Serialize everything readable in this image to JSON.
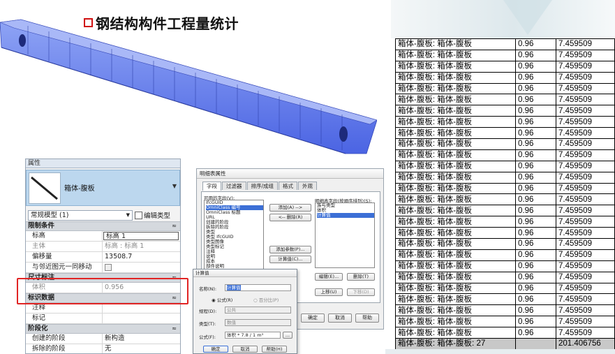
{
  "title": "钢结构构件工程量统计",
  "schedule": {
    "rows": [
      {
        "name": "箱体-腹板: 箱体-腹板",
        "value": "0.96",
        "volume": "7.459509"
      },
      {
        "name": "箱体-腹板: 箱体-腹板",
        "value": "0.96",
        "volume": "7.459509"
      },
      {
        "name": "箱体-腹板: 箱体-腹板",
        "value": "0.96",
        "volume": "7.459509"
      },
      {
        "name": "箱体-腹板: 箱体-腹板",
        "value": "0.96",
        "volume": "7.459509"
      },
      {
        "name": "箱体-腹板: 箱体-腹板",
        "value": "0.96",
        "volume": "7.459509"
      },
      {
        "name": "箱体-腹板: 箱体-腹板",
        "value": "0.96",
        "volume": "7.459509"
      },
      {
        "name": "箱体-腹板: 箱体-腹板",
        "value": "0.96",
        "volume": "7.459509"
      },
      {
        "name": "箱体-腹板: 箱体-腹板",
        "value": "0.96",
        "volume": "7.459509"
      },
      {
        "name": "箱体-腹板: 箱体-腹板",
        "value": "0.96",
        "volume": "7.459509"
      },
      {
        "name": "箱体-腹板: 箱体-腹板",
        "value": "0.96",
        "volume": "7.459509"
      },
      {
        "name": "箱体-腹板: 箱体-腹板",
        "value": "0.96",
        "volume": "7.459509"
      },
      {
        "name": "箱体-腹板: 箱体-腹板",
        "value": "0.96",
        "volume": "7.459509"
      },
      {
        "name": "箱体-腹板: 箱体-腹板",
        "value": "0.96",
        "volume": "7.459509"
      },
      {
        "name": "箱体-腹板: 箱体-腹板",
        "value": "0.96",
        "volume": "7.459509"
      },
      {
        "name": "箱体-腹板: 箱体-腹板",
        "value": "0.96",
        "volume": "7.459509"
      },
      {
        "name": "箱体-腹板: 箱体-腹板",
        "value": "0.96",
        "volume": "7.459509"
      },
      {
        "name": "箱体-腹板: 箱体-腹板",
        "value": "0.96",
        "volume": "7.459509"
      },
      {
        "name": "箱体-腹板: 箱体-腹板",
        "value": "0.96",
        "volume": "7.459509"
      },
      {
        "name": "箱体-腹板: 箱体-腹板",
        "value": "0.96",
        "volume": "7.459509"
      },
      {
        "name": "箱体-腹板: 箱体-腹板",
        "value": "0.96",
        "volume": "7.459509"
      },
      {
        "name": "箱体-腹板: 箱体-腹板",
        "value": "0.96",
        "volume": "7.459509"
      },
      {
        "name": "箱体-腹板: 箱体-腹板",
        "value": "0.96",
        "volume": "7.459509"
      },
      {
        "name": "箱体-腹板: 箱体-腹板",
        "value": "0.96",
        "volume": "7.459509"
      },
      {
        "name": "箱体-腹板: 箱体-腹板",
        "value": "0.96",
        "volume": "7.459509"
      },
      {
        "name": "箱体-腹板: 箱体-腹板",
        "value": "0.96",
        "volume": "7.459509"
      },
      {
        "name": "箱体-腹板: 箱体-腹板",
        "value": "0.96",
        "volume": "7.459509"
      },
      {
        "name": "箱体-腹板: 箱体-腹板",
        "value": "0.96",
        "volume": "7.459509"
      }
    ],
    "total": {
      "name": "箱体-腹板: 箱体-腹板: 27",
      "value": "",
      "volume": "201.406756"
    }
  },
  "properties": {
    "header": "属性",
    "type_name": "箱体-腹板",
    "filter_value": "常规模型 (1)",
    "edit_type_label": "编辑类型",
    "sections": {
      "constraints": "限制条件",
      "dimensions": "尺寸标注",
      "identity": "标识数据",
      "phasing": "阶段化"
    },
    "rows": {
      "level_key": "标高",
      "level_val": "标高 1",
      "host_key": "主体",
      "host_val": "标高 : 标高 1",
      "offset_key": "偏移量",
      "offset_val": "13508.7",
      "move_key": "与邻近图元一同移动",
      "volume_key": "体积",
      "volume_val": "0.956",
      "comment_key": "注释",
      "mark_key": "标记",
      "phase_created_key": "创建的阶段",
      "phase_created_val": "新构造",
      "phase_demolished_key": "拆除的阶段",
      "phase_demolished_val": "无"
    },
    "collapse_glyph": "≈"
  },
  "schedule_dialog": {
    "title": "明细表属性",
    "tabs": [
      "字段",
      "过滤器",
      "排序/成组",
      "格式",
      "外观"
    ],
    "available_label": "可用的字段(V):",
    "available_fields": [
      "IfcGUID",
      "OmniClass 编号",
      "OmniClass 标题",
      "URL",
      "创建的阶段",
      "拆除的阶段",
      "类型",
      "类型 IfcGUID",
      "类型图像",
      "类型标记",
      "注释",
      "说明",
      "成本",
      "部件说明",
      "部件代码",
      "族",
      "族与类型",
      "标高",
      "标记"
    ],
    "add_button": "添加(A) -->",
    "remove_button": "<-- 删除(R)",
    "add_param_button": "添加参数(P)...",
    "calc_button": "计算值(C)...",
    "scheduled_label": "明细表字段(按顺序排列)(S):",
    "scheduled_fields": [
      "族与类型",
      "体积",
      "计算值"
    ],
    "edit_button": "编辑(E)...",
    "delete_button": "删除(T)",
    "up_button": "上移(U)",
    "down_button": "下移(D)",
    "ok_button": "确定",
    "cancel_button": "取消",
    "help_button": "帮助"
  },
  "calc_dialog": {
    "title": "计算值",
    "name_label": "名称(N):",
    "name_value": "计算值",
    "formula_radio": "公式(R)",
    "percent_radio": "百分比(P)",
    "discipline_label": "规程(D):",
    "discipline_value": "公共",
    "type_label": "类型(T):",
    "type_value": "数值",
    "formula_label": "公式(F):",
    "formula_value": "体积 * 7.8 / 1 m³",
    "ellipsis": "...",
    "ok": "确定",
    "cancel": "取消",
    "help": "帮助(H)"
  }
}
